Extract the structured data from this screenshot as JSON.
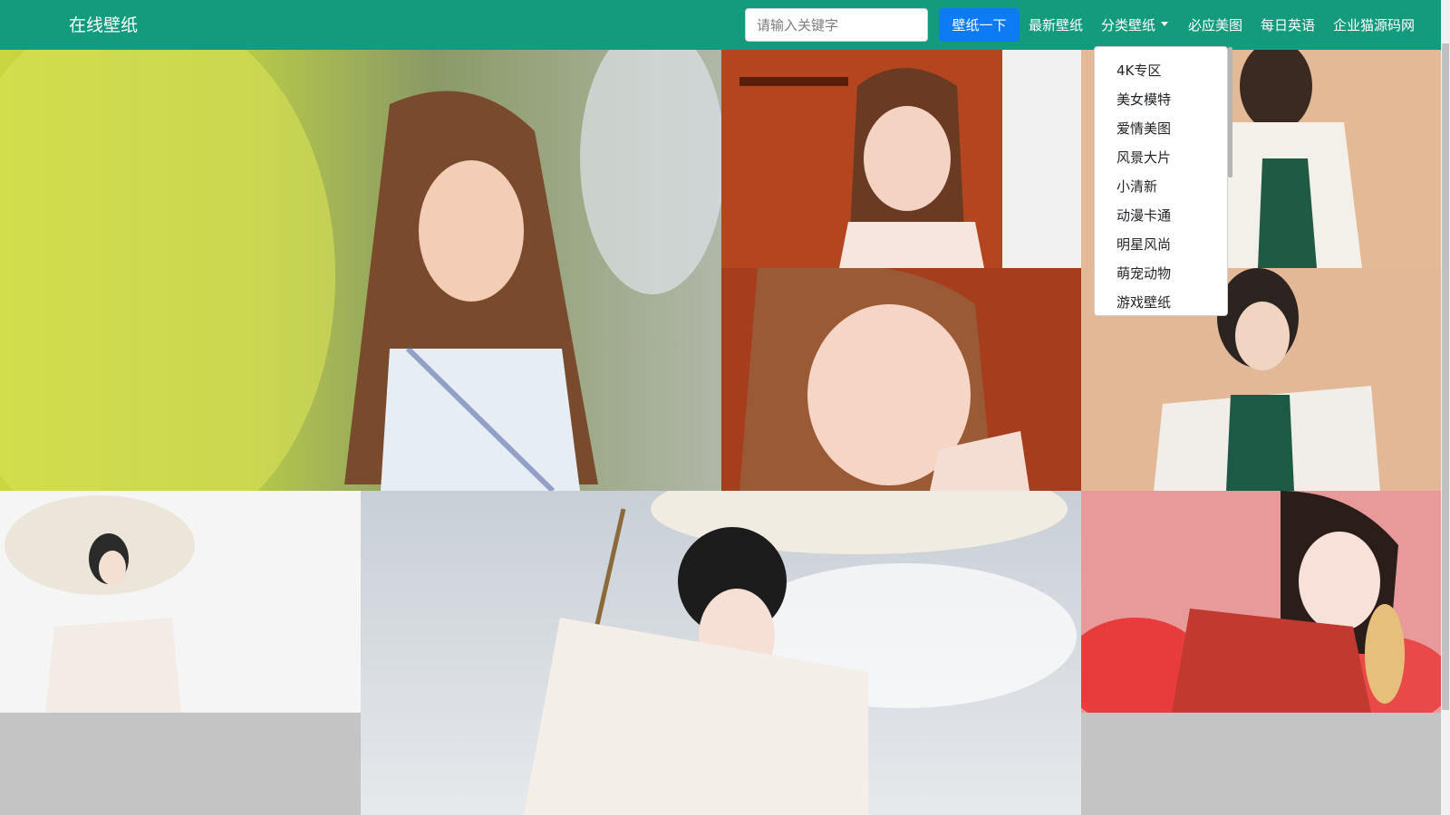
{
  "header": {
    "brand": "在线壁纸",
    "search_placeholder": "请输入关键字",
    "search_button": "壁纸一下",
    "nav": {
      "latest": "最新壁纸",
      "categories": "分类壁纸",
      "bing": "必应美图",
      "daily_english": "每日英语",
      "enterprise": "企业猫源码网"
    }
  },
  "dropdown": {
    "items": [
      "4K专区",
      "美女模特",
      "爱情美图",
      "风景大片",
      "小清新",
      "动漫卡通",
      "明星风尚",
      "萌宠动物",
      "游戏壁纸"
    ]
  },
  "colors": {
    "navbar": "#149b7e",
    "button": "#0d7bf6",
    "background": "#c4c4c4"
  }
}
